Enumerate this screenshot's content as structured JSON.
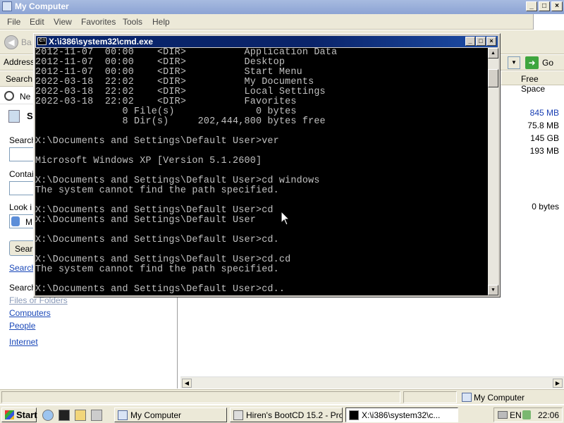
{
  "explorer": {
    "title": "My Computer",
    "window_buttons": [
      "_",
      "□",
      "×"
    ],
    "menu": [
      "File",
      "Edit",
      "View",
      "Favorites",
      "Tools",
      "Help"
    ],
    "toolbar": {
      "back_label": "Ba"
    },
    "address": {
      "label": "Address",
      "go_label": "Go"
    },
    "search_pane": {
      "header": "Search",
      "new_label": "Ne",
      "section_title": "S",
      "search_label": "Search",
      "containing_label": "Contai",
      "look_in_label": "Look i",
      "look_in_value": "M",
      "search_button": "Sear",
      "search_link": "Search",
      "search_for_label": "Search",
      "links": [
        "Files or Folders",
        "Computers",
        "People",
        "Internet"
      ]
    },
    "list": {
      "free_space_header": "Free Space",
      "free_space_values": [
        "845 MB",
        "75.8 MB",
        "145 GB",
        "193 MB",
        "0 bytes"
      ]
    },
    "status": {
      "location": "My Computer"
    }
  },
  "cmd": {
    "title": "X:\\i386\\system32\\cmd.exe",
    "lines": [
      "2012-11-07  00:00    <DIR>          Application Data",
      "2012-11-07  00:00    <DIR>          Desktop",
      "2012-11-07  00:00    <DIR>          Start Menu",
      "2022-03-18  22:02    <DIR>          My Documents",
      "2022-03-18  22:02    <DIR>          Local Settings",
      "2022-03-18  22:02    <DIR>          Favorites",
      "               0 File(s)              0 bytes",
      "               8 Dir(s)     202,444,800 bytes free",
      "",
      "X:\\Documents and Settings\\Default User>ver",
      "",
      "Microsoft Windows XP [Version 5.1.2600]",
      "",
      "X:\\Documents and Settings\\Default User>cd windows",
      "The system cannot find the path specified.",
      "",
      "X:\\Documents and Settings\\Default User>cd",
      "X:\\Documents and Settings\\Default User",
      "",
      "X:\\Documents and Settings\\Default User>cd.",
      "",
      "X:\\Documents and Settings\\Default User>cd.cd",
      "The system cannot find the path specified.",
      "",
      "X:\\Documents and Settings\\Default User>cd.."
    ]
  },
  "taskbar": {
    "start_label": "Start",
    "tasks": [
      "My Computer",
      "Hiren's BootCD 15.2 - Pro...",
      "X:\\i386\\system32\\c..."
    ],
    "tray": {
      "language": "EN",
      "clock": "22:06"
    }
  },
  "colors": {
    "console_bg": "#000000",
    "console_fg": "#c0c0c0",
    "title_active": "#0a246a",
    "link": "#1a48b8"
  }
}
